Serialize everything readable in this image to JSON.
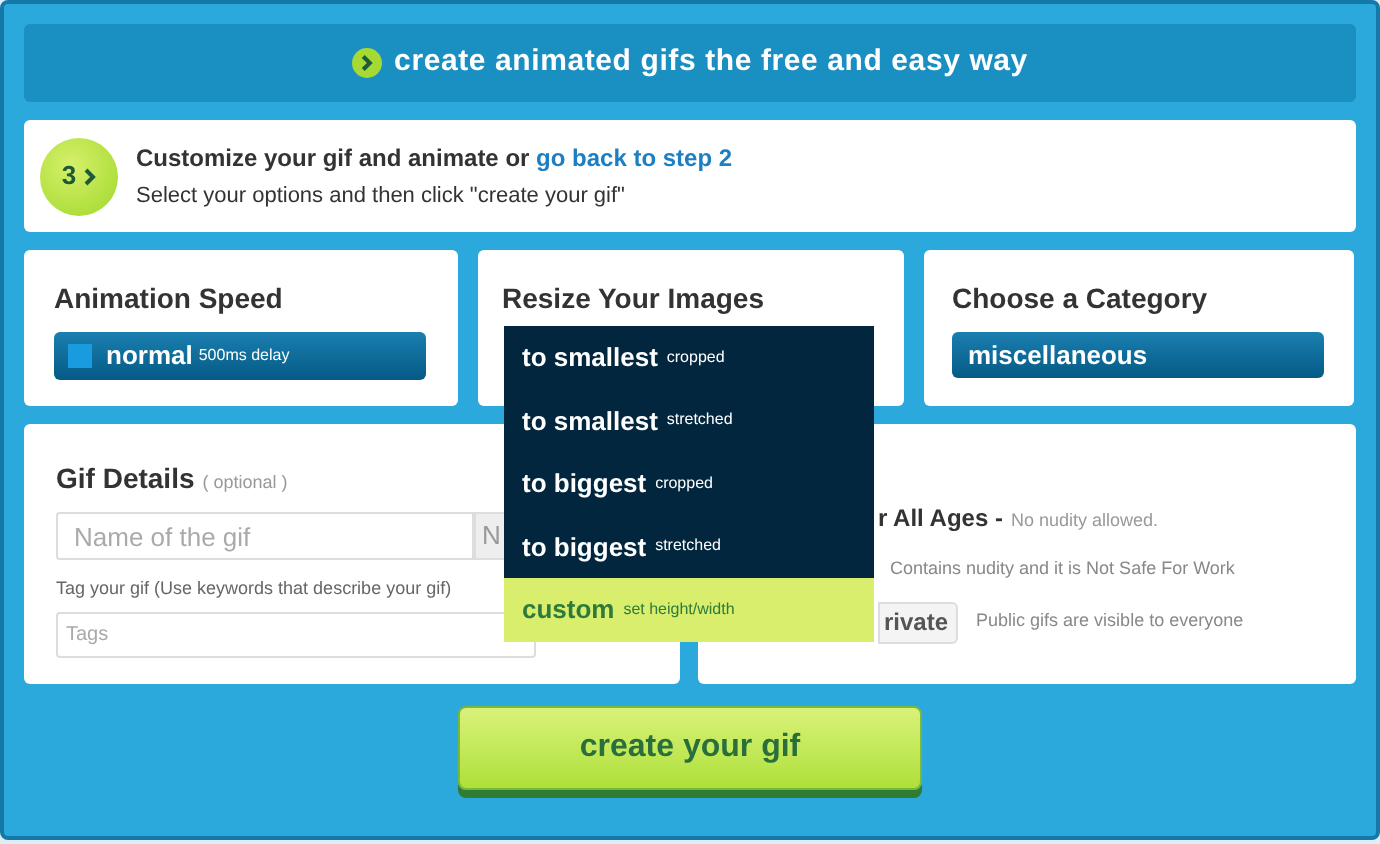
{
  "header": {
    "title": "create animated gifs the free and easy way"
  },
  "step": {
    "number": "3",
    "title": "Customize your gif and animate or ",
    "link": "go back to step 2",
    "subtitle": "Select your options and then click \"create your gif\""
  },
  "speed": {
    "title": "Animation Speed",
    "value": "normal",
    "note": "500ms delay"
  },
  "resize": {
    "title": "Resize Your Images",
    "options": [
      {
        "label": "to smallest",
        "note": "cropped",
        "selected": false
      },
      {
        "label": "to smallest",
        "note": "stretched",
        "selected": false
      },
      {
        "label": "to biggest",
        "note": "cropped",
        "selected": false
      },
      {
        "label": "to biggest",
        "note": "stretched",
        "selected": false
      },
      {
        "label": "custom",
        "note": "set height/width",
        "selected": true
      }
    ]
  },
  "category": {
    "title": "Choose a Category",
    "value": "miscellaneous"
  },
  "details": {
    "title": "Gif Details",
    "optional": "( optional )",
    "name_placeholder": "Name of the gif",
    "name_addon": "N",
    "tags_label": "Tag your gif (Use keywords that describe your gif)",
    "tags_placeholder": "Tags"
  },
  "rating": {
    "all_ages": "r All Ages -",
    "all_ages_note": "No nudity allowed.",
    "nsfw_note": "Contains nudity and it is Not Safe For Work",
    "privacy_button": "rivate",
    "privacy_note": "Public gifs are visible to everyone"
  },
  "submit": "create your gif"
}
